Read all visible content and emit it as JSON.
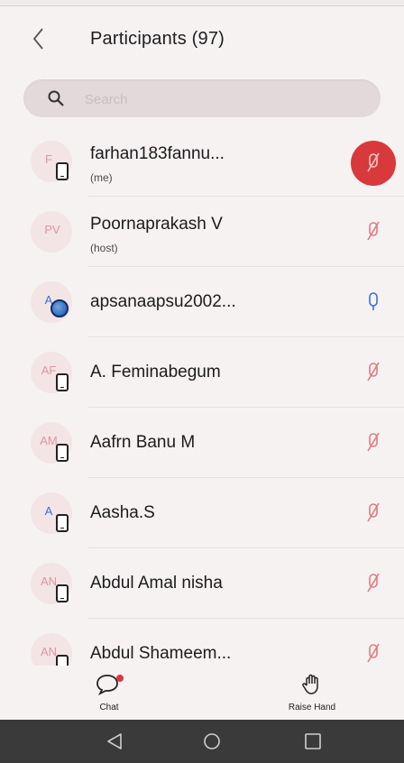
{
  "header": {
    "title": "Participants (97)"
  },
  "search": {
    "placeholder": "Search"
  },
  "participants": [
    {
      "initials": "F",
      "name": "farhan183fannu...",
      "sub": "(me)",
      "device": "phone",
      "mic": "muted-active"
    },
    {
      "initials": "PV",
      "name": "Poornaprakash V",
      "sub": "(host)",
      "device": "none",
      "mic": "muted"
    },
    {
      "initials": "A",
      "name": "apsanaapsu2002...",
      "sub": "",
      "device": "web",
      "mic": "unmuted"
    },
    {
      "initials": "AF",
      "name": "A. Feminabegum",
      "sub": "",
      "device": "phone",
      "mic": "muted"
    },
    {
      "initials": "AM",
      "name": "Aafrn Banu M",
      "sub": "",
      "device": "phone",
      "mic": "muted"
    },
    {
      "initials": "A",
      "name": "Aasha.S",
      "sub": "",
      "device": "phone",
      "mic": "muted"
    },
    {
      "initials": "AN",
      "name": "Abdul Amal nisha",
      "sub": "",
      "device": "phone",
      "mic": "muted"
    },
    {
      "initials": "AN",
      "name": "Abdul Shameem...",
      "sub": "",
      "device": "phone",
      "mic": "muted"
    }
  ],
  "tabs": {
    "chat": "Chat",
    "raise_hand": "Raise Hand"
  },
  "colors": {
    "accent_red": "#d8393b",
    "muted_mic": "#e07b80",
    "unmuted_mic": "#3a6fd3",
    "nav_bar": "#3a3a3a"
  }
}
